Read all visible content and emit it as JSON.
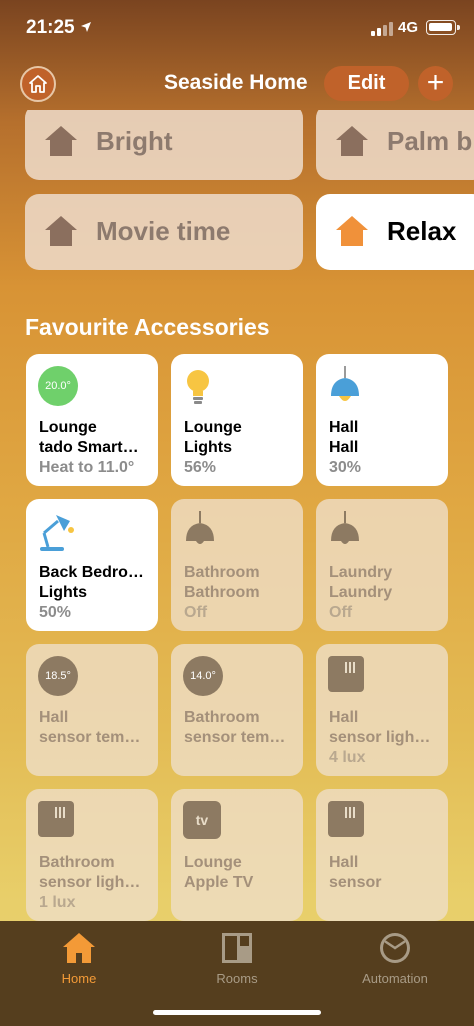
{
  "status_bar": {
    "time": "21:25",
    "network": "4G"
  },
  "header": {
    "title": "Seaside Home",
    "edit_label": "Edit",
    "add_label": "+"
  },
  "scenes": [
    {
      "label": "Bright",
      "active": false
    },
    {
      "label": "Palm b",
      "active": false
    },
    {
      "label": "Movie time",
      "active": false
    },
    {
      "label": "Relax",
      "active": true
    }
  ],
  "favourites": {
    "title": "Favourite Accessories",
    "tiles": [
      {
        "line1": "Lounge",
        "line2": "tado Smart…",
        "line3": "Heat to 11.0°",
        "badge": "20.0°",
        "icon": "thermostat-icon",
        "state": "on"
      },
      {
        "line1": "Lounge",
        "line2": "Lights",
        "line3": "56%",
        "icon": "lightbulb-icon",
        "state": "on"
      },
      {
        "line1": "Hall",
        "line2": "Hall",
        "line3": "30%",
        "icon": "pendant-lamp-icon",
        "state": "on"
      },
      {
        "line1": "Back Bedro…",
        "line2": "Lights",
        "line3": "50%",
        "icon": "desk-lamp-icon",
        "state": "on"
      },
      {
        "line1": "Bathroom",
        "line2": "Bathroom",
        "line3": "Off",
        "icon": "pendant-lamp-icon",
        "state": "off"
      },
      {
        "line1": "Laundry",
        "line2": "Laundry",
        "line3": "Off",
        "icon": "pendant-lamp-icon",
        "state": "off"
      },
      {
        "line1": "Hall",
        "line2": "sensor tem…",
        "line3": "",
        "badge": "18.5°",
        "icon": "temperature-sensor-icon",
        "state": "off"
      },
      {
        "line1": "Bathroom",
        "line2": "sensor tem…",
        "line3": "",
        "badge": "14.0°",
        "icon": "temperature-sensor-icon",
        "state": "off"
      },
      {
        "line1": "Hall",
        "line2": "sensor ligh…",
        "line3": "4 lux",
        "icon": "light-sensor-icon",
        "state": "off"
      },
      {
        "line1": "Bathroom",
        "line2": "sensor ligh…",
        "line3": "1 lux",
        "icon": "light-sensor-icon",
        "state": "off"
      },
      {
        "line1": "Lounge",
        "line2": "Apple TV",
        "line3": "",
        "tv_label": "tv",
        "icon": "apple-tv-icon",
        "state": "off"
      },
      {
        "line1": "Hall",
        "line2": "sensor",
        "line3": "",
        "icon": "sensor-icon",
        "state": "off"
      }
    ]
  },
  "tab_bar": {
    "tabs": [
      {
        "label": "Home",
        "icon": "home-icon",
        "active": true
      },
      {
        "label": "Rooms",
        "icon": "rooms-icon",
        "active": false
      },
      {
        "label": "Automation",
        "icon": "automation-icon",
        "active": false
      }
    ]
  },
  "colors": {
    "accent": "#c0622a",
    "active_tab": "#f39a37",
    "thermostat_badge": "#6fd06b",
    "sensor_badge": "#8d7a62",
    "bulb": "#f7c542",
    "lamp_shade": "#4a9fd8"
  }
}
